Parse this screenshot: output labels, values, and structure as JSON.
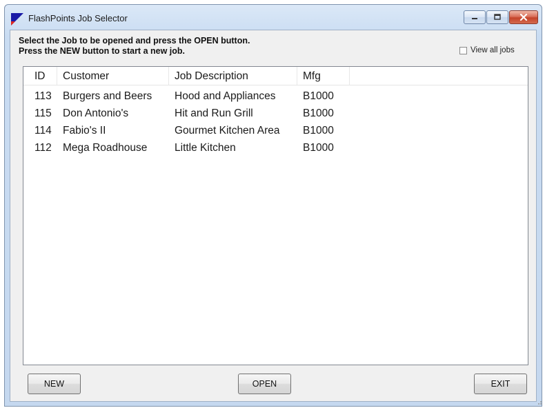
{
  "window": {
    "title": "FlashPoints Job Selector"
  },
  "instructions": {
    "line1": "Select the Job to be opened and press the OPEN button.",
    "line2": "Press the NEW button to start a new job."
  },
  "view_all": {
    "label": "View all jobs",
    "checked": false
  },
  "table": {
    "columns": [
      "ID",
      "Customer",
      "Job Description",
      "Mfg"
    ],
    "rows": [
      [
        "113",
        "Burgers and Beers",
        "Hood and Appliances",
        "B1000"
      ],
      [
        "115",
        "Don Antonio's",
        "Hit and Run Grill",
        "B1000"
      ],
      [
        "114",
        "Fabio's II",
        "Gourmet Kitchen Area",
        "B1000"
      ],
      [
        "112",
        "Mega Roadhouse",
        "Little Kitchen",
        "B1000"
      ]
    ]
  },
  "buttons": {
    "new_label": "NEW",
    "open_label": "OPEN",
    "exit_label": "EXIT"
  },
  "colors": {
    "window_frame": "#c5d8ef",
    "client_bg": "#f0f0f0",
    "close_button": "#c4432a",
    "app_icon_primary": "#1a1aa6",
    "app_icon_secondary": "#e0261e"
  },
  "icons": {
    "app": "flashpoints-app-icon",
    "minimize": "minimize-icon",
    "maximize": "maximize-icon",
    "close": "close-icon"
  }
}
